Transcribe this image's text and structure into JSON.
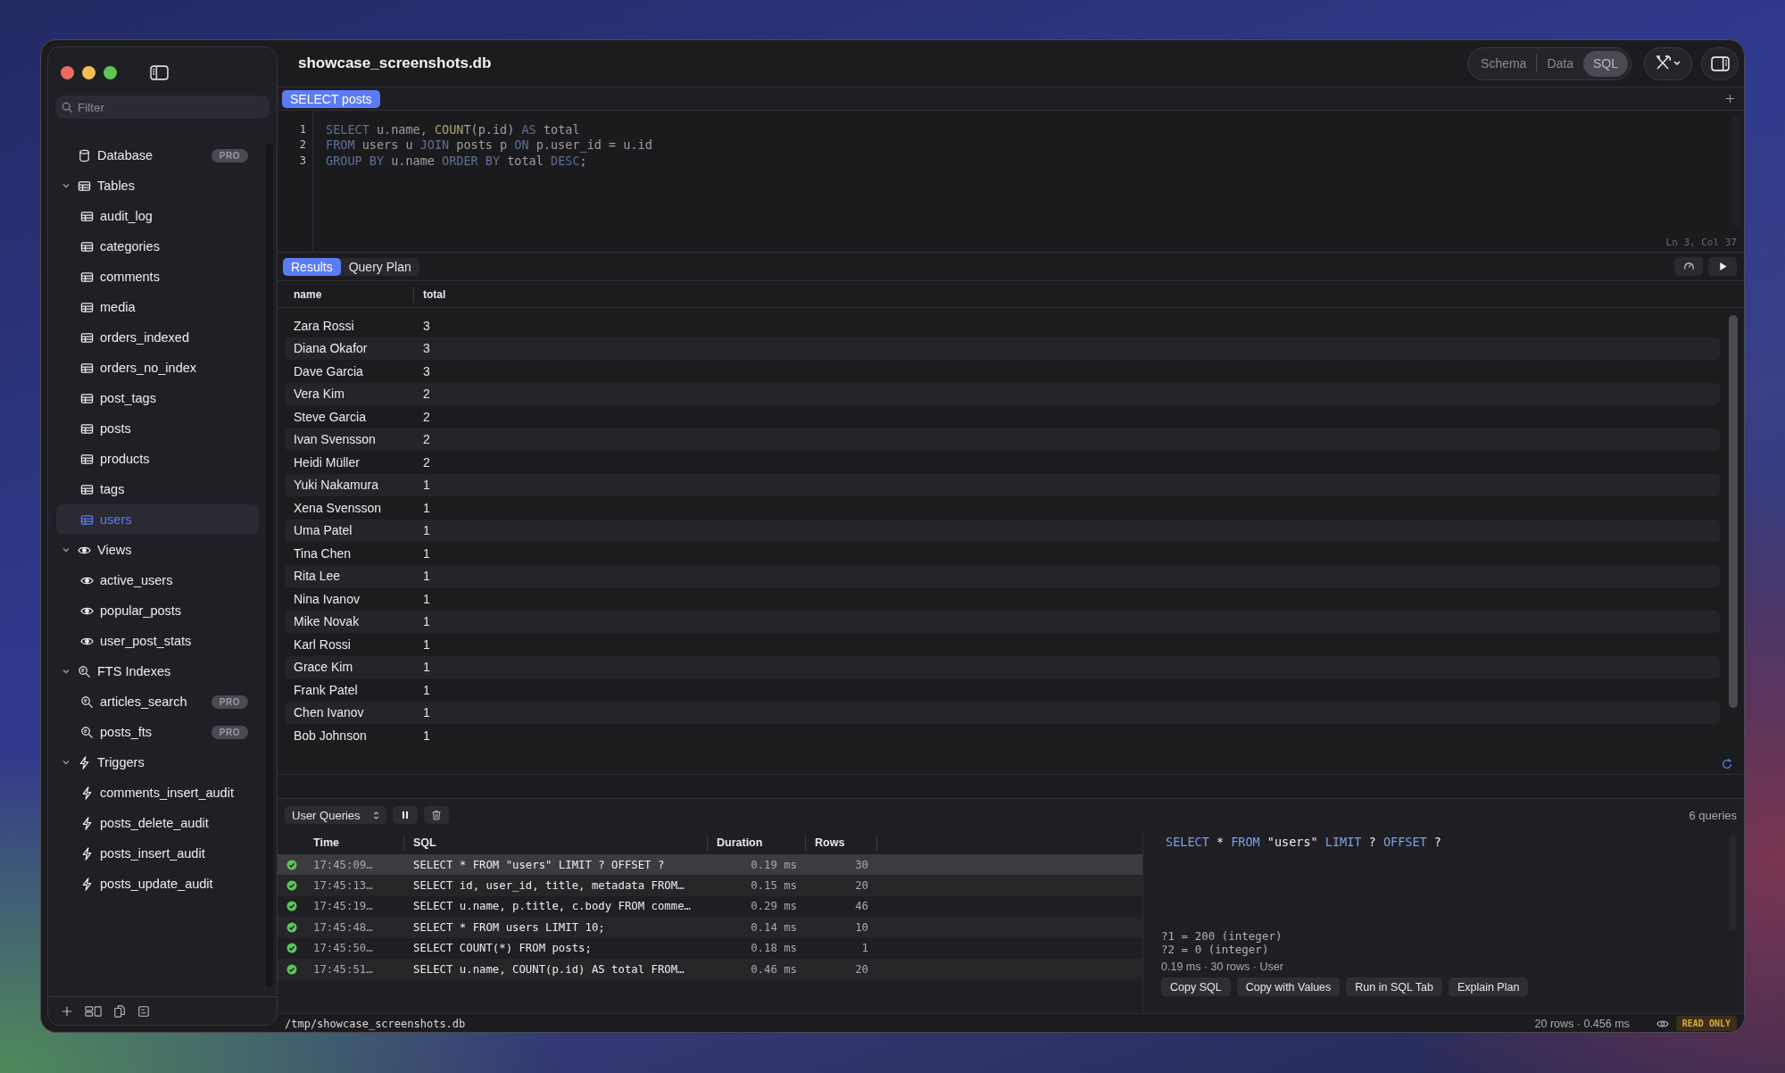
{
  "window": {
    "title": "showcase_screenshots.db"
  },
  "sidebar": {
    "filter_placeholder": "Filter",
    "tree": [
      {
        "label": "Database",
        "kind": "database",
        "badge": "PRO",
        "selected": false
      },
      {
        "label": "Tables",
        "kind": "table",
        "expanded": true,
        "children": [
          {
            "label": "audit_log",
            "selected": false
          },
          {
            "label": "categories",
            "selected": false
          },
          {
            "label": "comments",
            "selected": false
          },
          {
            "label": "media",
            "selected": false
          },
          {
            "label": "orders_indexed",
            "selected": false
          },
          {
            "label": "orders_no_index",
            "selected": false
          },
          {
            "label": "post_tags",
            "selected": false
          },
          {
            "label": "posts",
            "selected": false
          },
          {
            "label": "products",
            "selected": false
          },
          {
            "label": "tags",
            "selected": false
          },
          {
            "label": "users",
            "selected": true
          }
        ]
      },
      {
        "label": "Views",
        "kind": "view",
        "expanded": true,
        "children": [
          {
            "label": "active_users",
            "selected": false
          },
          {
            "label": "popular_posts",
            "selected": false
          },
          {
            "label": "user_post_stats",
            "selected": false
          }
        ]
      },
      {
        "label": "FTS Indexes",
        "kind": "fts",
        "expanded": true,
        "children": [
          {
            "label": "articles_search",
            "badge": "PRO",
            "selected": false
          },
          {
            "label": "posts_fts",
            "badge": "PRO",
            "selected": false
          }
        ]
      },
      {
        "label": "Triggers",
        "kind": "trigger",
        "expanded": true,
        "children": [
          {
            "label": "comments_insert_audit",
            "selected": false
          },
          {
            "label": "posts_delete_audit",
            "selected": false
          },
          {
            "label": "posts_insert_audit",
            "selected": false
          },
          {
            "label": "posts_update_audit",
            "selected": false
          }
        ]
      }
    ]
  },
  "view_switcher": [
    {
      "label": "Schema",
      "selected": false
    },
    {
      "label": "Data",
      "selected": false
    },
    {
      "label": "SQL",
      "selected": true
    }
  ],
  "query_tabs": [
    {
      "label": "SELECT posts",
      "selected": true
    }
  ],
  "editor": {
    "lines": [
      {
        "number": "1",
        "tokens": [
          {
            "t": "SELECT",
            "kind": "keyword"
          },
          {
            "t": " u.name, ",
            "kind": "plain"
          },
          {
            "t": "COUNT",
            "kind": "function"
          },
          {
            "t": "(p.id) ",
            "kind": "plain"
          },
          {
            "t": "AS",
            "kind": "keyword"
          },
          {
            "t": " total",
            "kind": "plain"
          }
        ]
      },
      {
        "number": "2",
        "tokens": [
          {
            "t": "FROM",
            "kind": "keyword"
          },
          {
            "t": " users u ",
            "kind": "plain"
          },
          {
            "t": "JOIN",
            "kind": "keyword"
          },
          {
            "t": " posts p ",
            "kind": "plain"
          },
          {
            "t": "ON",
            "kind": "keyword"
          },
          {
            "t": " p.user_id = u.id",
            "kind": "plain"
          }
        ]
      },
      {
        "number": "3",
        "tokens": [
          {
            "t": "GROUP BY",
            "kind": "keyword"
          },
          {
            "t": " u.name ",
            "kind": "plain"
          },
          {
            "t": "ORDER BY",
            "kind": "keyword"
          },
          {
            "t": " total ",
            "kind": "plain"
          },
          {
            "t": "DESC",
            "kind": "keyword"
          },
          {
            "t": ";",
            "kind": "plain"
          }
        ]
      }
    ],
    "cursor_position": "Ln 3, Col 37"
  },
  "result_tabs": [
    {
      "label": "Results",
      "selected": true
    },
    {
      "label": "Query Plan",
      "selected": false
    }
  ],
  "results": {
    "columns": [
      "name",
      "total"
    ],
    "rows": [
      [
        "Zara Rossi",
        "3"
      ],
      [
        "Diana Okafor",
        "3"
      ],
      [
        "Dave Garcia",
        "3"
      ],
      [
        "Vera Kim",
        "2"
      ],
      [
        "Steve Garcia",
        "2"
      ],
      [
        "Ivan Svensson",
        "2"
      ],
      [
        "Heidi Müller",
        "2"
      ],
      [
        "Yuki Nakamura",
        "1"
      ],
      [
        "Xena Svensson",
        "1"
      ],
      [
        "Uma Patel",
        "1"
      ],
      [
        "Tina Chen",
        "1"
      ],
      [
        "Rita Lee",
        "1"
      ],
      [
        "Nina Ivanov",
        "1"
      ],
      [
        "Mike Novak",
        "1"
      ],
      [
        "Karl Rossi",
        "1"
      ],
      [
        "Grace Kim",
        "1"
      ],
      [
        "Frank Patel",
        "1"
      ],
      [
        "Chen Ivanov",
        "1"
      ],
      [
        "Bob Johnson",
        "1"
      ]
    ]
  },
  "query_log": {
    "filter": "User Queries",
    "count": "6 queries",
    "columns": [
      "Time",
      "SQL",
      "Duration",
      "Rows"
    ],
    "rows": [
      {
        "success": true,
        "time": "17:45:09…",
        "sql": "SELECT * FROM \"users\" LIMIT ? OFFSET ?",
        "duration": "0.19 ms",
        "rows": "30",
        "selected": true
      },
      {
        "success": true,
        "time": "17:45:13…",
        "sql": "SELECT id, user_id, title, metadata FROM…",
        "duration": "0.15 ms",
        "rows": "20",
        "selected": false
      },
      {
        "success": true,
        "time": "17:45:19…",
        "sql": "SELECT u.name, p.title, c.body FROM comme…",
        "duration": "0.29 ms",
        "rows": "46",
        "selected": false
      },
      {
        "success": true,
        "time": "17:45:48…",
        "sql": "SELECT * FROM users LIMIT 10;",
        "duration": "0.14 ms",
        "rows": "10",
        "selected": false
      },
      {
        "success": true,
        "time": "17:45:50…",
        "sql": "SELECT COUNT(*) FROM posts;",
        "duration": "0.18 ms",
        "rows": "1",
        "selected": false
      },
      {
        "success": true,
        "time": "17:45:51…",
        "sql": "SELECT u.name, COUNT(p.id) AS total FROM…",
        "duration": "0.46 ms",
        "rows": "20",
        "selected": false
      }
    ],
    "detail": {
      "tokens": [
        {
          "t": "SELECT",
          "kind": "keyword"
        },
        {
          "t": " * ",
          "kind": "plain"
        },
        {
          "t": "FROM",
          "kind": "keyword"
        },
        {
          "t": " \"users\" ",
          "kind": "plain"
        },
        {
          "t": "LIMIT",
          "kind": "keyword"
        },
        {
          "t": " ? ",
          "kind": "plain"
        },
        {
          "t": "OFFSET",
          "kind": "keyword"
        },
        {
          "t": " ?",
          "kind": "plain"
        }
      ],
      "params": [
        "?1 = 200 (integer)",
        "?2 = 0 (integer)"
      ],
      "meta": "0.19 ms · 30 rows · User",
      "actions": [
        "Copy SQL",
        "Copy with Values",
        "Run in SQL Tab",
        "Explain Plan"
      ]
    }
  },
  "status_bar": {
    "path": "/tmp/showcase_screenshots.db",
    "summary": "20 rows · 0.456 ms",
    "badge": "READ ONLY"
  }
}
